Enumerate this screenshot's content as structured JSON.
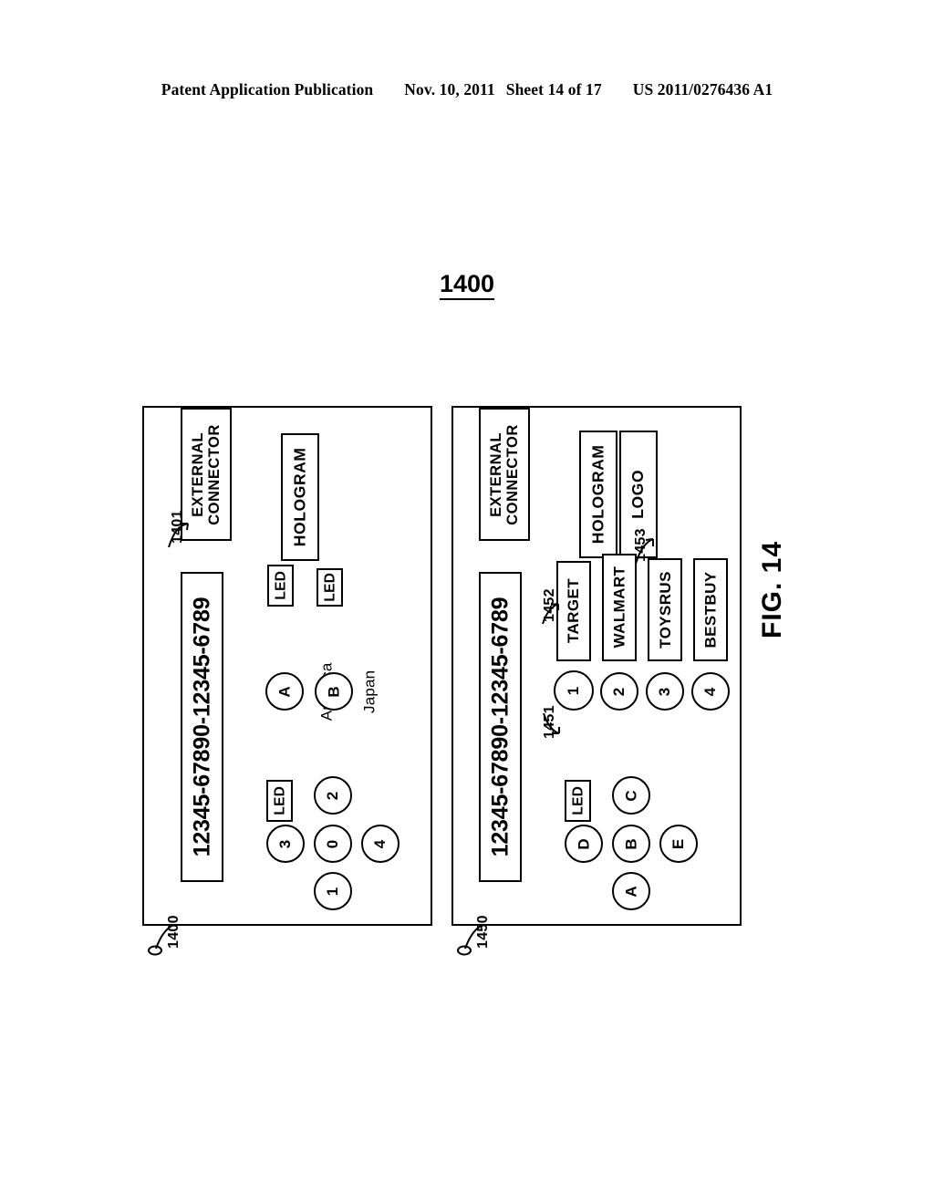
{
  "header": {
    "publication": "Patent Application Publication",
    "date": "Nov. 10, 2011",
    "sheet": "Sheet 14 of 17",
    "patent_number": "US 2011/0276436 A1"
  },
  "figure": {
    "top_number": "1400",
    "caption": "FIG. 14"
  },
  "panels": [
    {
      "ref": "1400",
      "external_connector": "EXTERNAL\nCONNECTOR",
      "external_connector_line1": "EXTERNAL",
      "external_connector_line2": "CONNECTOR",
      "external_connector_ref": "1401",
      "hologram": "HOLOGRAM",
      "serial": "12345-67890-12345-6789",
      "keypad_led": "LED",
      "keypad": {
        "top": "2",
        "left": "3",
        "center": "0",
        "right": "4",
        "bottom": "1"
      },
      "selector_rows": [
        {
          "button": "A",
          "label": "America",
          "led": "LED"
        },
        {
          "button": "B",
          "label": "Japan",
          "led": "LED"
        }
      ]
    },
    {
      "ref": "1450",
      "external_connector_line1": "EXTERNAL",
      "external_connector_line2": "CONNECTOR",
      "hologram": "HOLOGRAM",
      "logo": "LOGO",
      "logo_ref": "1453",
      "serial": "12345-67890-12345-6789",
      "keypad_led": "LED",
      "keypad": {
        "top": "C",
        "left": "D",
        "center": "B",
        "right": "E",
        "bottom": "A"
      },
      "button_ref": "1451",
      "label_ref": "1452",
      "store_rows": [
        {
          "button": "1",
          "label": "TARGET"
        },
        {
          "button": "2",
          "label": "WALMART"
        },
        {
          "button": "3",
          "label": "TOYSRUS"
        },
        {
          "button": "4",
          "label": "BESTBUY"
        }
      ]
    }
  ],
  "colors": {
    "ink": "#000000",
    "paper": "#ffffff"
  }
}
